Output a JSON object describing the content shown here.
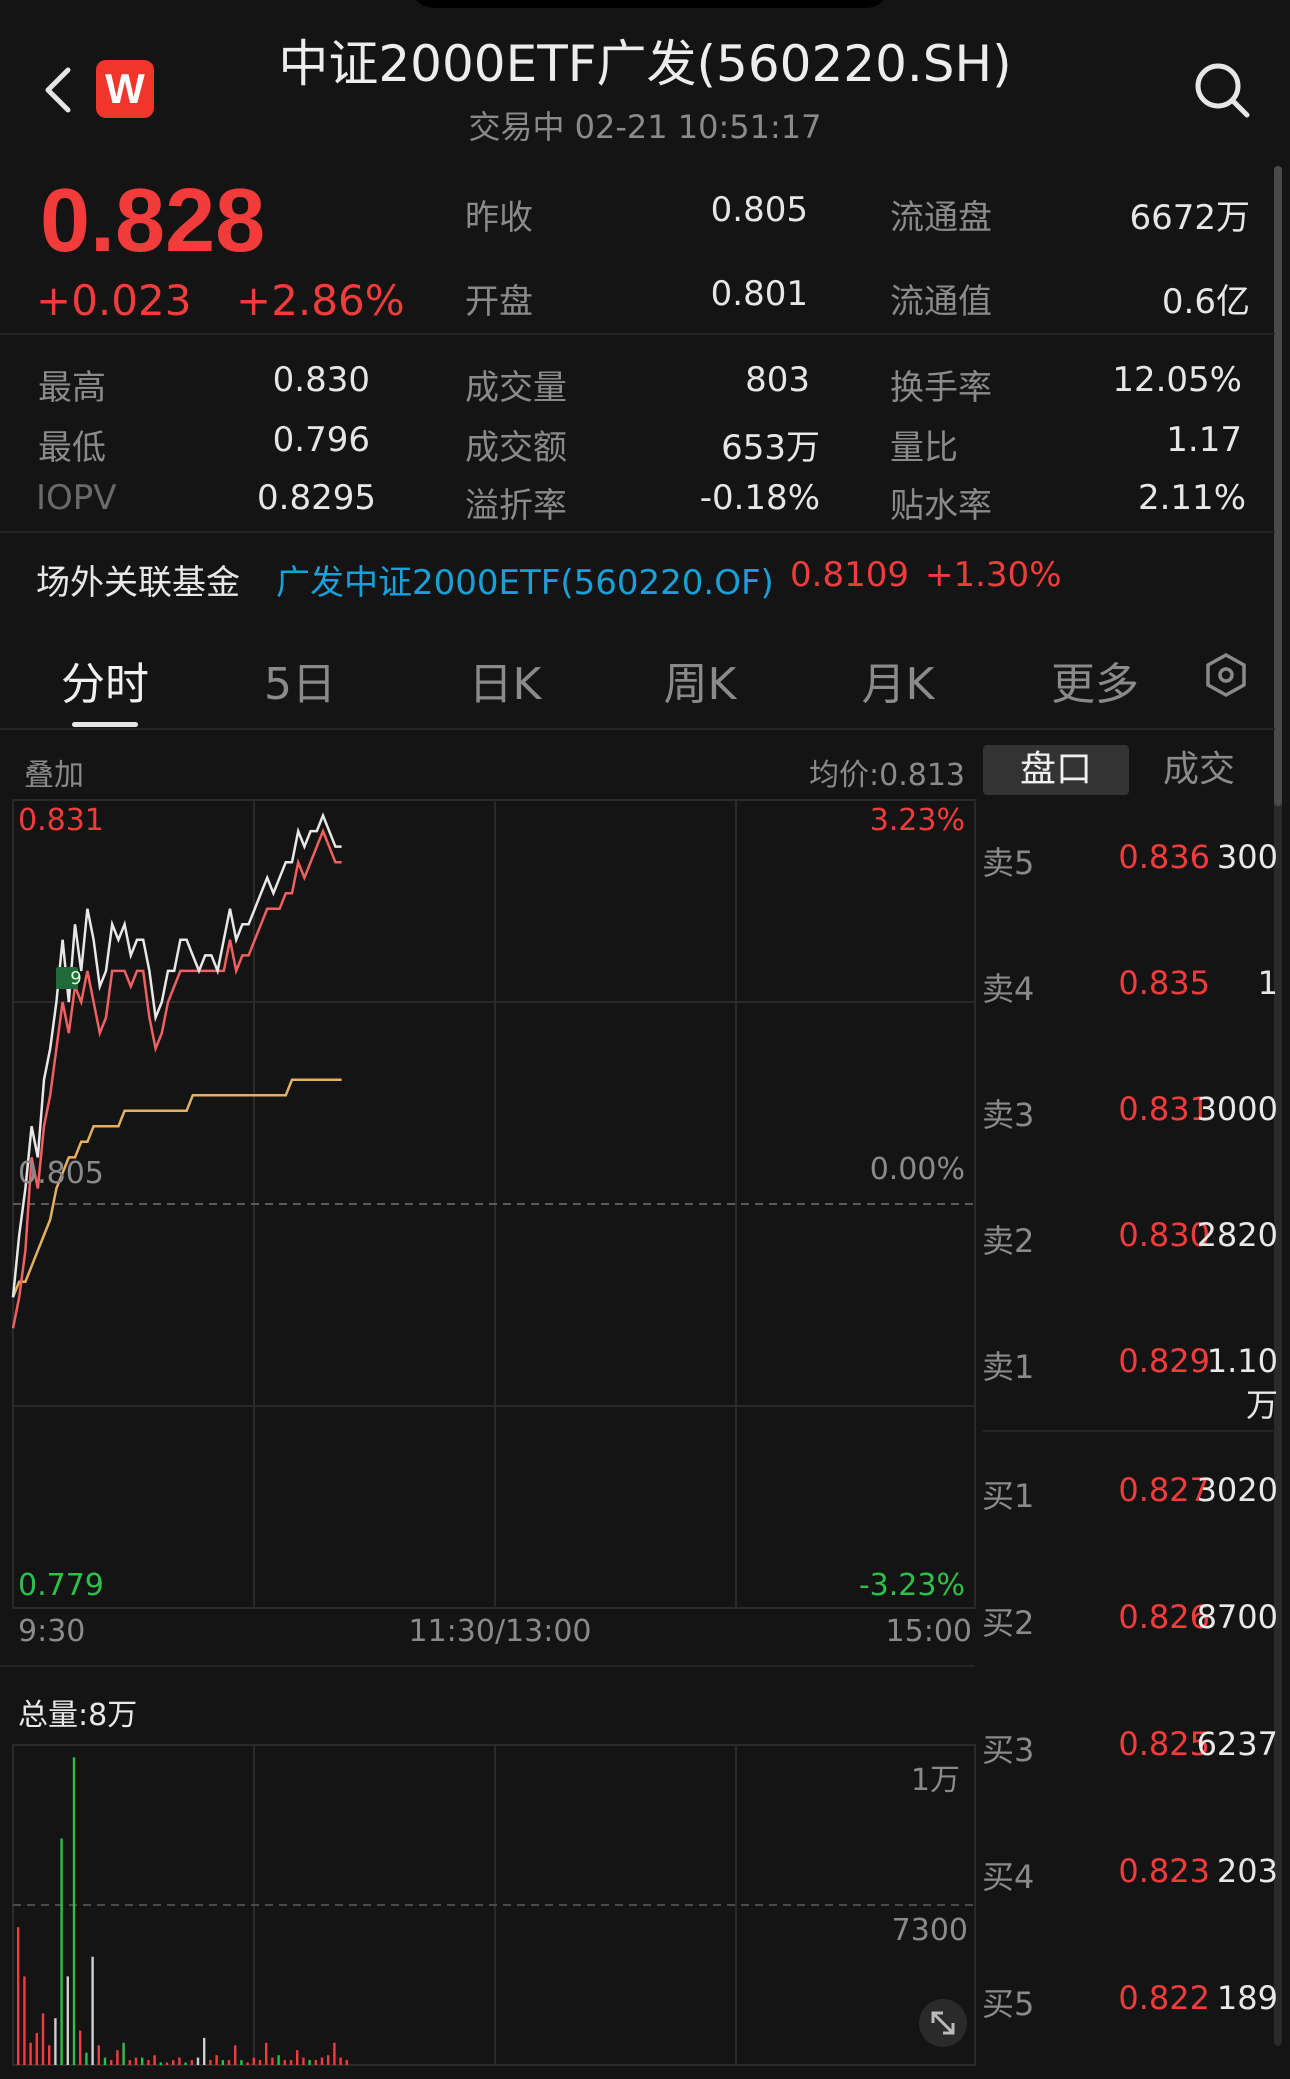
{
  "header": {
    "title": "中证2000ETF广发(560220.SH)",
    "status": "交易中 02-21 10:51:17",
    "logo_letter": "W"
  },
  "quote": {
    "price": "0.828",
    "change": "+0.023",
    "change_pct": "+2.86%",
    "rows": [
      [
        {
          "label": "昨收",
          "value": "0.805"
        },
        {
          "label": "流通盘",
          "value": "6672万"
        }
      ],
      [
        {
          "label": "开盘",
          "value": "0.801"
        },
        {
          "label": "流通值",
          "value": "0.6亿"
        }
      ]
    ],
    "grid": [
      [
        {
          "label": "最高",
          "value": "0.830"
        },
        {
          "label": "成交量",
          "value": "803"
        },
        {
          "label": "换手率",
          "value": "12.05%"
        }
      ],
      [
        {
          "label": "最低",
          "value": "0.796"
        },
        {
          "label": "成交额",
          "value": "653万"
        },
        {
          "label": "量比",
          "value": "1.17"
        }
      ],
      [
        {
          "label": "IOPV",
          "value": "0.8295"
        },
        {
          "label": "溢折率",
          "value": "-0.18%"
        },
        {
          "label": "贴水率",
          "value": "2.11%"
        }
      ]
    ]
  },
  "related_fund": {
    "label": "场外关联基金",
    "name": "广发中证2000ETF(560220.OF)",
    "nav": "0.8109",
    "change": "+1.30%"
  },
  "tabs": [
    "分时",
    "5日",
    "日K",
    "周K",
    "月K",
    "更多"
  ],
  "chart": {
    "overlay_label": "叠加",
    "avg_price_label": "均价:0.813",
    "price_high": "0.831",
    "price_base": "0.805",
    "price_low": "0.779",
    "pct_high": "3.23%",
    "pct_base": "0.00%",
    "pct_low": "-3.23%",
    "marker": "9",
    "time_start": "9:30",
    "time_mid": "11:30/13:00",
    "time_end": "15:00",
    "volume_label": "总量:8万",
    "volume_ticks": [
      "1万",
      "7300"
    ]
  },
  "chart_data": {
    "type": "line",
    "ylim": [
      0.779,
      0.831
    ],
    "series": [
      {
        "values": [
          0.799,
          0.803,
          0.806,
          0.81,
          0.808,
          0.813,
          0.815,
          0.818,
          0.822,
          0.818,
          0.823,
          0.82,
          0.824,
          0.822,
          0.819,
          0.82,
          0.823,
          0.822,
          0.823,
          0.821,
          0.822,
          0.822,
          0.82,
          0.817,
          0.818,
          0.82,
          0.82,
          0.822,
          0.822,
          0.821,
          0.82,
          0.821,
          0.821,
          0.82,
          0.822,
          0.824,
          0.822,
          0.823,
          0.823,
          0.824,
          0.825,
          0.826,
          0.825,
          0.826,
          0.827,
          0.827,
          0.829,
          0.828,
          0.829,
          0.829,
          0.83,
          0.829,
          0.828,
          0.828
        ]
      },
      {
        "values": [
          0.797,
          0.799,
          0.802,
          0.808,
          0.806,
          0.81,
          0.812,
          0.815,
          0.818,
          0.816,
          0.819,
          0.818,
          0.82,
          0.818,
          0.816,
          0.817,
          0.82,
          0.82,
          0.82,
          0.819,
          0.82,
          0.82,
          0.817,
          0.815,
          0.816,
          0.818,
          0.819,
          0.82,
          0.82,
          0.82,
          0.82,
          0.82,
          0.82,
          0.82,
          0.82,
          0.822,
          0.82,
          0.821,
          0.821,
          0.822,
          0.823,
          0.824,
          0.824,
          0.824,
          0.825,
          0.825,
          0.827,
          0.826,
          0.827,
          0.828,
          0.829,
          0.828,
          0.827,
          0.827
        ]
      },
      {
        "values": [
          0.799,
          0.8,
          0.8,
          0.801,
          0.802,
          0.803,
          0.804,
          0.806,
          0.807,
          0.808,
          0.808,
          0.809,
          0.809,
          0.81,
          0.81,
          0.81,
          0.81,
          0.81,
          0.811,
          0.811,
          0.811,
          0.811,
          0.811,
          0.811,
          0.811,
          0.811,
          0.811,
          0.811,
          0.811,
          0.812,
          0.812,
          0.812,
          0.812,
          0.812,
          0.812,
          0.812,
          0.812,
          0.812,
          0.812,
          0.812,
          0.812,
          0.812,
          0.812,
          0.812,
          0.812,
          0.813,
          0.813,
          0.813,
          0.813,
          0.813,
          0.813,
          0.813,
          0.813,
          0.813
        ]
      }
    ],
    "volume": [
      5600,
      3600,
      900,
      1300,
      2100,
      800,
      1900,
      9200,
      3600,
      12500,
      1400,
      500,
      4400,
      800,
      300,
      200,
      600,
      900,
      200,
      300,
      300,
      200,
      400,
      100,
      100,
      200,
      300,
      100,
      200,
      300,
      1100,
      200,
      400,
      200,
      200,
      800,
      200,
      100,
      300,
      200,
      900,
      300,
      400,
      200,
      200,
      600,
      300,
      200,
      200,
      300,
      400,
      900,
      300,
      200
    ],
    "volume_colors": [
      "red",
      "red",
      "red",
      "red",
      "red",
      "red",
      "white",
      "green",
      "white",
      "green",
      "red",
      "green",
      "white",
      "red",
      "green",
      "red",
      "red",
      "green",
      "red",
      "red",
      "green",
      "red",
      "red",
      "green",
      "red",
      "red",
      "red",
      "green",
      "red",
      "white",
      "white",
      "red",
      "red",
      "green",
      "red",
      "red",
      "green",
      "red",
      "red",
      "red",
      "red",
      "red",
      "green",
      "red",
      "red",
      "red",
      "red",
      "green",
      "red",
      "red",
      "red",
      "red",
      "red",
      "red"
    ]
  },
  "orderbook": {
    "seg_on": "盘口",
    "seg_off": "成交",
    "sell": [
      {
        "label": "卖5",
        "price": "0.836",
        "vol": "300"
      },
      {
        "label": "卖4",
        "price": "0.835",
        "vol": "1"
      },
      {
        "label": "卖3",
        "price": "0.831",
        "vol": "3000"
      },
      {
        "label": "卖2",
        "price": "0.830",
        "vol": "2820"
      },
      {
        "label": "卖1",
        "price": "0.829",
        "vol": "1.10万"
      }
    ],
    "buy": [
      {
        "label": "买1",
        "price": "0.827",
        "vol": "3020"
      },
      {
        "label": "买2",
        "price": "0.826",
        "vol": "8700"
      },
      {
        "label": "买3",
        "price": "0.825",
        "vol": "6237"
      },
      {
        "label": "买4",
        "price": "0.823",
        "vol": "203"
      },
      {
        "label": "买5",
        "price": "0.822",
        "vol": "189"
      }
    ]
  }
}
